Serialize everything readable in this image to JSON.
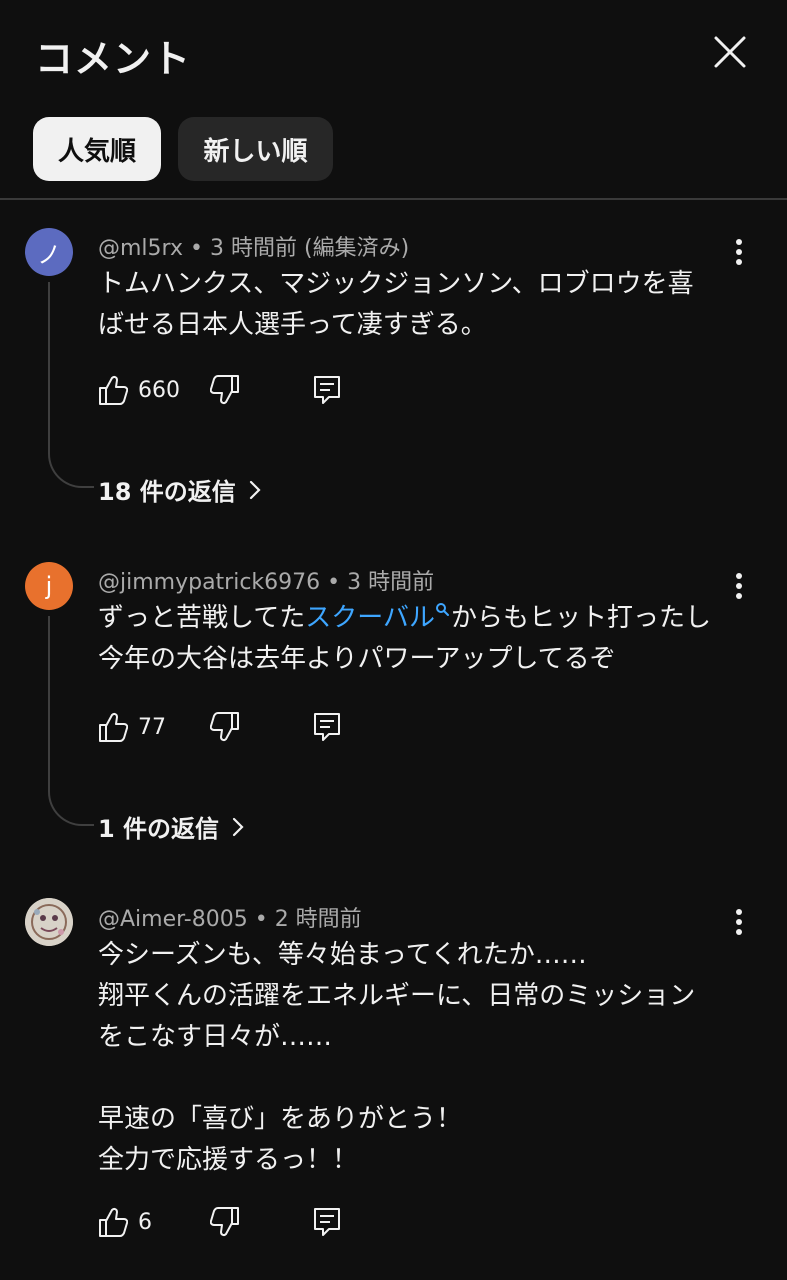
{
  "header": {
    "title": "コメント"
  },
  "sort_chips": [
    {
      "label": "人気順",
      "active": true
    },
    {
      "label": "新しい順",
      "active": false
    }
  ],
  "icons": {
    "close": "close-icon",
    "menu": "more-vert-icon",
    "like": "thumbs-up-icon",
    "dislike": "thumbs-down-icon",
    "reply": "reply-icon",
    "chevron": "chevron-right-icon"
  },
  "comments": [
    {
      "avatar_letter": "ノ",
      "avatar_color": "#5c6bc0",
      "author": "@ml5rx",
      "time": "3 時間前 (編集済み)",
      "text": "トムハンクス、マジックジョンソン、ロブロウを喜ばせる日本人選手って凄すぎる。",
      "likes": "660",
      "replies": "18 件の返信"
    },
    {
      "avatar_letter": "j",
      "avatar_color": "#e8712d",
      "author": "@jimmypatrick6976",
      "time": "3 時間前",
      "text_before_link": "ずっと苦戦してた",
      "link_text": "スクーバル",
      "text_after_link": "からもヒット打ったし\n今年の大谷は去年よりパワーアップしてるぞ",
      "likes": "77",
      "replies": "1 件の返信"
    },
    {
      "avatar_letter": "",
      "avatar_color": "#cfc8be",
      "author": "@Aimer-8005",
      "time": "2 時間前",
      "text": "今シーズンも、等々始まってくれたか……\n翔平くんの活躍をエネルギーに、日常のミッションをこなす日々が……\n\n早速の「喜び」をありがとう！\n全力で応援するっ！！",
      "likes": "6"
    }
  ]
}
